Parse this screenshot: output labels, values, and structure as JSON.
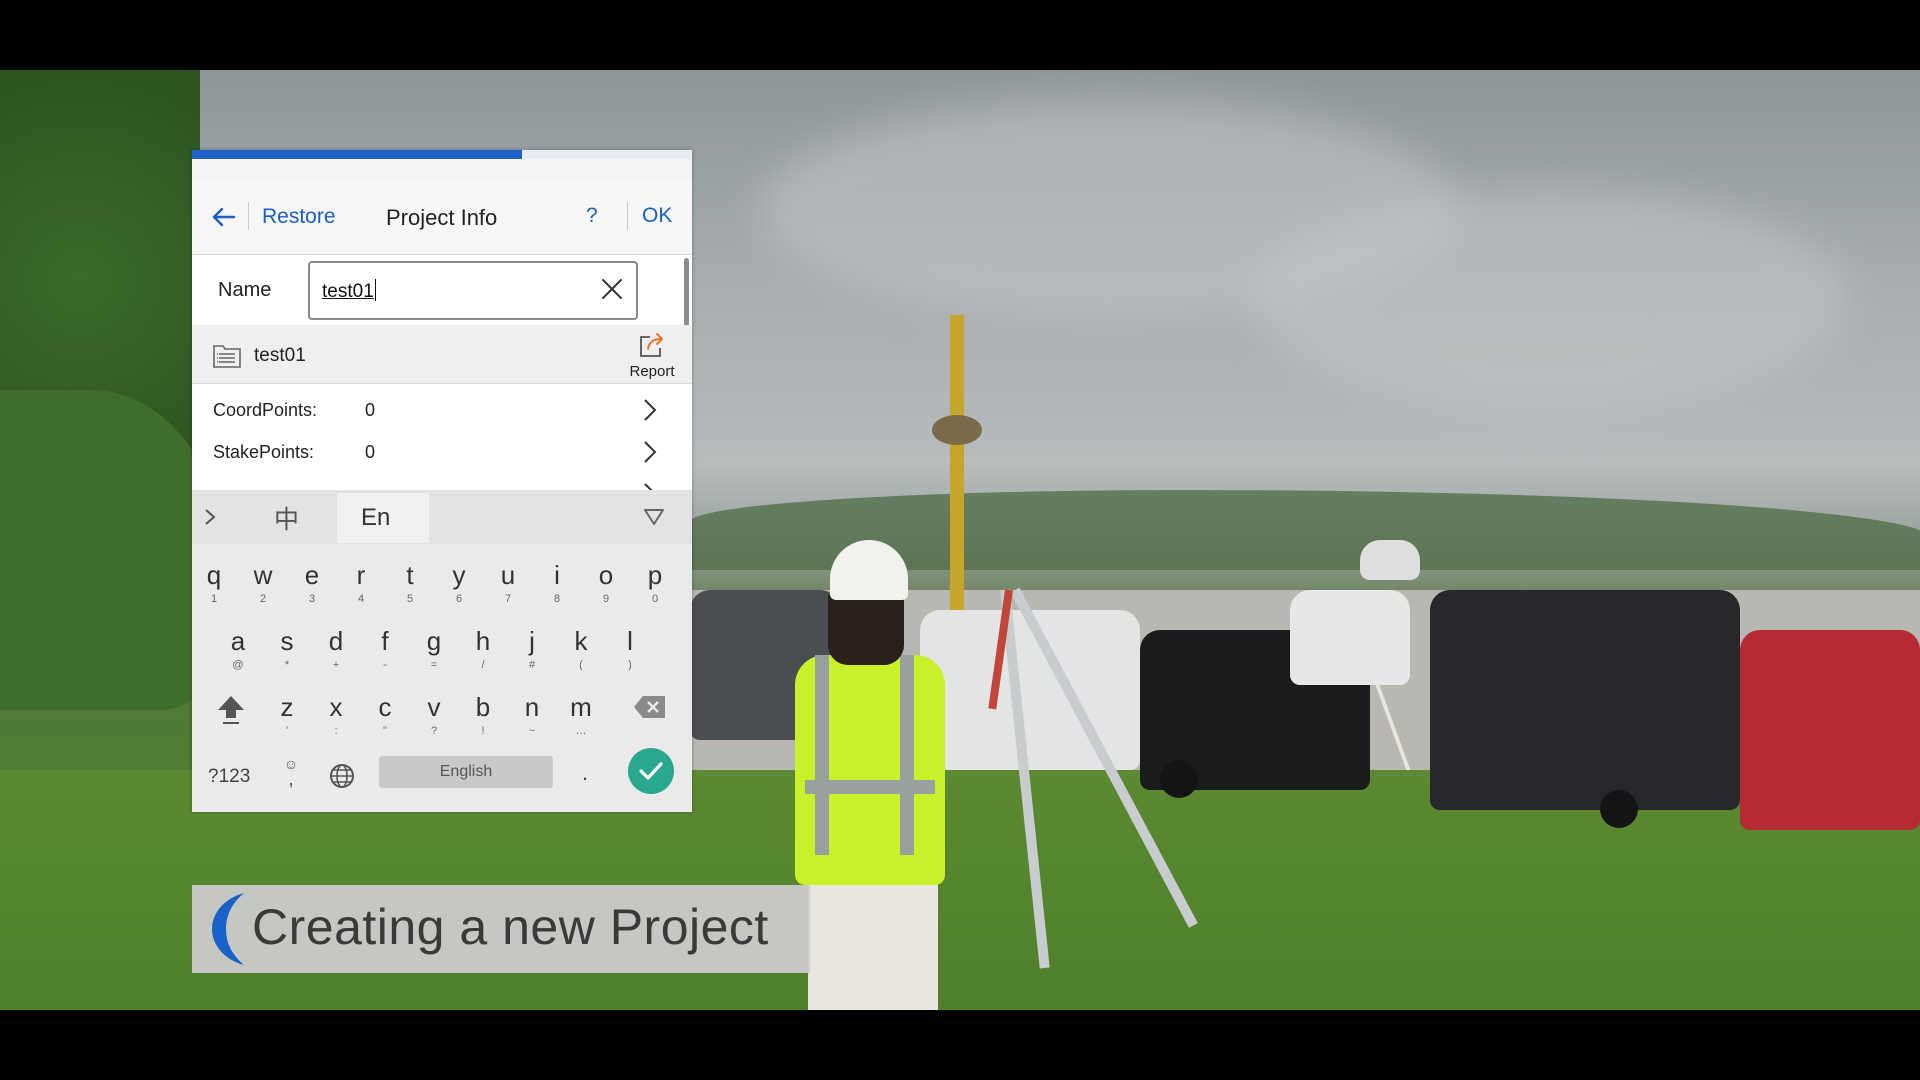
{
  "app": {
    "progress_percent": 66,
    "title": "Project Info",
    "back_icon": "arrow-left-icon",
    "restore_label": "Restore",
    "help_label": "?",
    "ok_label": "OK",
    "accent_color": "#1b5fc4"
  },
  "name_field": {
    "label": "Name",
    "value": "test01",
    "clear_icon": "close-icon"
  },
  "project": {
    "name": "test01",
    "icon": "document-icon",
    "report_label": "Report",
    "report_icon": "export-icon"
  },
  "info_rows": [
    {
      "label": "CoordPoints:",
      "value": "0"
    },
    {
      "label": "StakePoints:",
      "value": "0"
    }
  ],
  "keyboard": {
    "lang_cn": "中",
    "lang_en": "En",
    "row1": [
      {
        "k": "q",
        "s": "1"
      },
      {
        "k": "w",
        "s": "2"
      },
      {
        "k": "e",
        "s": "3"
      },
      {
        "k": "r",
        "s": "4"
      },
      {
        "k": "t",
        "s": "5"
      },
      {
        "k": "y",
        "s": "6"
      },
      {
        "k": "u",
        "s": "7"
      },
      {
        "k": "i",
        "s": "8"
      },
      {
        "k": "o",
        "s": "9"
      },
      {
        "k": "p",
        "s": "0"
      }
    ],
    "row2": [
      {
        "k": "a",
        "s": "@"
      },
      {
        "k": "s",
        "s": "*"
      },
      {
        "k": "d",
        "s": "+"
      },
      {
        "k": "f",
        "s": "-"
      },
      {
        "k": "g",
        "s": "="
      },
      {
        "k": "h",
        "s": "/"
      },
      {
        "k": "j",
        "s": "#"
      },
      {
        "k": "k",
        "s": "("
      },
      {
        "k": "l",
        "s": ")"
      }
    ],
    "row3": [
      {
        "k": "z",
        "s": "'"
      },
      {
        "k": "x",
        "s": ":"
      },
      {
        "k": "c",
        "s": "\""
      },
      {
        "k": "v",
        "s": "?"
      },
      {
        "k": "b",
        "s": "!"
      },
      {
        "k": "n",
        "s": "~"
      },
      {
        "k": "m",
        "s": "…"
      }
    ],
    "sym_label": "?123",
    "space_label": "English",
    "period_label": ".",
    "emoji_comma": ","
  },
  "caption": {
    "text": "Creating a new Project"
  }
}
